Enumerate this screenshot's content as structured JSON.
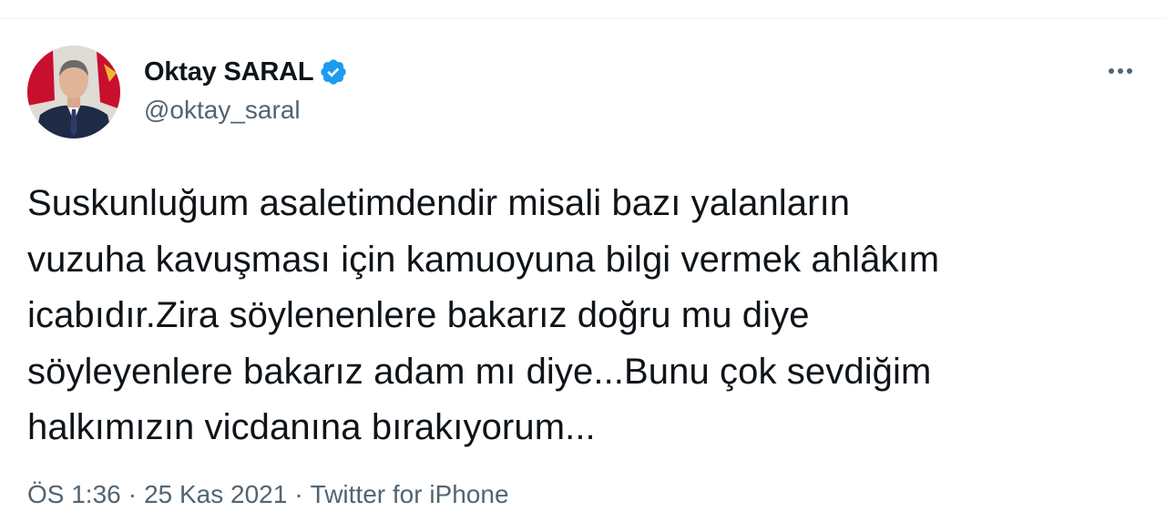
{
  "tweet": {
    "author": {
      "display_name": "Oktay SARAL",
      "handle": "@oktay_saral",
      "verified": true,
      "avatar_icon": "profile-photo"
    },
    "more_icon": "more-horizontal-icon",
    "text": "Suskunluğum asaletimdendir misali bazı yalanların\nvuzuha kavuşması için kamuoyuna bilgi vermek ahlâkım\nicabıdır.Zira söylenenlere bakarız doğru mu diye\nsöyleyenlere bakarız adam mı diye...Bunu çok sevdiğim\nhalkımızın vicdanına bırakıyorum...",
    "meta": {
      "time": "ÖS 1:36",
      "separator": "·",
      "date": "25 Kas 2021",
      "source": "Twitter for iPhone"
    },
    "colors": {
      "verified": "#1d9bf0",
      "secondary_text": "#536471",
      "primary_text": "#0f1419"
    }
  }
}
